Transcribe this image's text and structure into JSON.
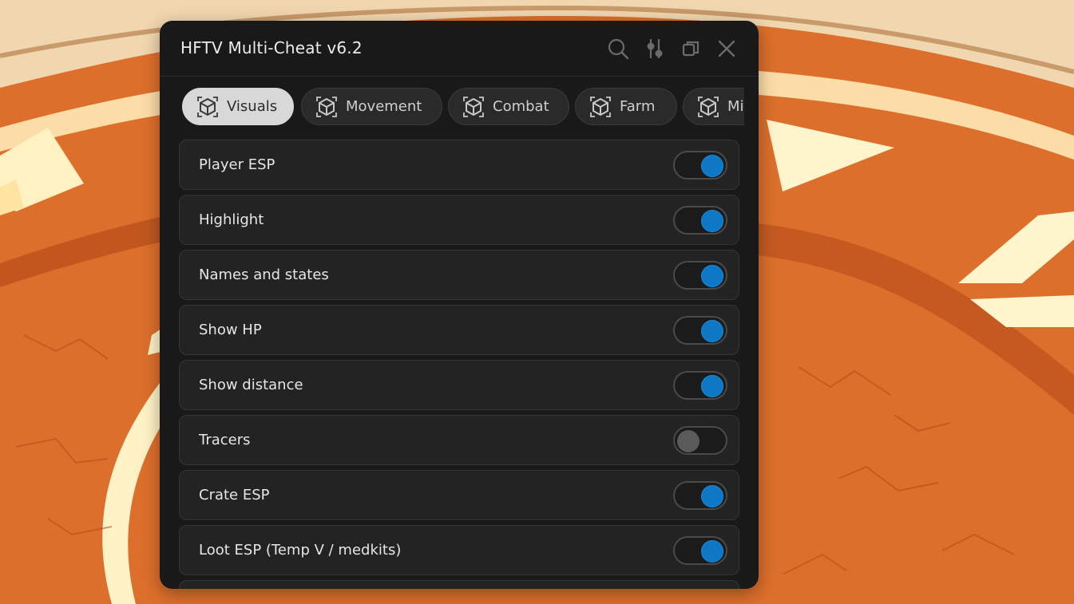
{
  "window": {
    "title": "HFTV Multi-Cheat v6.2",
    "titlebar_icons": [
      "search-icon",
      "sliders-icon",
      "copy-icon",
      "close-icon"
    ]
  },
  "tabs": [
    {
      "label": "Visuals",
      "icon": "cube-icon",
      "active": true
    },
    {
      "label": "Movement",
      "icon": "cube-icon",
      "active": false
    },
    {
      "label": "Combat",
      "icon": "cube-icon",
      "active": false
    },
    {
      "label": "Farm",
      "icon": "cube-icon",
      "active": false
    },
    {
      "label": "Mi",
      "icon": "cube-icon",
      "active": false
    }
  ],
  "settings": [
    {
      "label": "Player ESP",
      "enabled": true
    },
    {
      "label": "Highlight",
      "enabled": true
    },
    {
      "label": "Names and states",
      "enabled": true
    },
    {
      "label": "Show HP",
      "enabled": true
    },
    {
      "label": "Show distance",
      "enabled": true
    },
    {
      "label": "Tracers",
      "enabled": false
    },
    {
      "label": "Crate ESP",
      "enabled": true
    },
    {
      "label": "Loot ESP (Temp V / medkits)",
      "enabled": true
    }
  ],
  "colors": {
    "window_bg": "#191919",
    "row_bg": "#232323",
    "toggle_on": "#0f78c4",
    "toggle_off": "#5a5a5a",
    "active_tab": "#d8d8d8"
  }
}
